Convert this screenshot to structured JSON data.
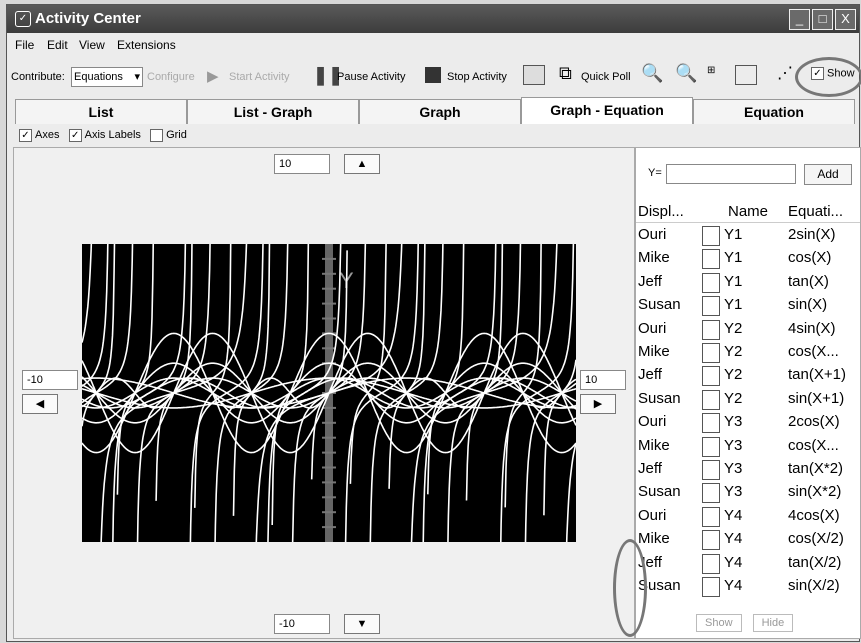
{
  "window": {
    "title": "Activity Center",
    "controls": [
      "_",
      "□",
      "X"
    ]
  },
  "menu": [
    "File",
    "Edit",
    "View",
    "Extensions"
  ],
  "toolbar": {
    "contribute_label": "Contribute:",
    "contribute_value": "Equations",
    "configure_label": "Configure",
    "start_label": "Start Activity",
    "pause_label": "Pause Activity",
    "stop_label": "Stop Activity",
    "quickpoll_label": "Quick Poll",
    "show_label": "Show"
  },
  "tabs": [
    "List",
    "List - Graph",
    "Graph",
    "Graph - Equation",
    "Equation"
  ],
  "active_tab": "Graph - Equation",
  "options": {
    "axes": "Axes",
    "axis_labels": "Axis Labels",
    "grid": "Grid"
  },
  "graph": {
    "ymax": "10",
    "ymin": "-10",
    "xmin": "-10",
    "xmax": "10",
    "y_axis_label": "Y"
  },
  "side": {
    "y_label": "Y=",
    "add_label": "Add",
    "headers": [
      "Displ...",
      "Name",
      "Equati..."
    ],
    "rows": [
      {
        "display": "Ouri",
        "name": "Y1",
        "eq": "2sin(X)"
      },
      {
        "display": "Mike",
        "name": "Y1",
        "eq": "cos(X)"
      },
      {
        "display": "Jeff",
        "name": "Y1",
        "eq": "tan(X)"
      },
      {
        "display": "Susan",
        "name": "Y1",
        "eq": "sin(X)"
      },
      {
        "display": "Ouri",
        "name": "Y2",
        "eq": "4sin(X)"
      },
      {
        "display": "Mike",
        "name": "Y2",
        "eq": "cos(X..."
      },
      {
        "display": "Jeff",
        "name": "Y2",
        "eq": "tan(X+1)"
      },
      {
        "display": "Susan",
        "name": "Y2",
        "eq": "sin(X+1)"
      },
      {
        "display": "Ouri",
        "name": "Y3",
        "eq": "2cos(X)"
      },
      {
        "display": "Mike",
        "name": "Y3",
        "eq": "cos(X..."
      },
      {
        "display": "Jeff",
        "name": "Y3",
        "eq": "tan(X*2)"
      },
      {
        "display": "Susan",
        "name": "Y3",
        "eq": "sin(X*2)"
      },
      {
        "display": "Ouri",
        "name": "Y4",
        "eq": "4cos(X)"
      },
      {
        "display": "Mike",
        "name": "Y4",
        "eq": "cos(X/2)"
      },
      {
        "display": "Jeff",
        "name": "Y4",
        "eq": "tan(X/2)"
      },
      {
        "display": "Susan",
        "name": "Y4",
        "eq": "sin(X/2)"
      }
    ],
    "show_btn": "Show",
    "hide_btn": "Hide"
  }
}
